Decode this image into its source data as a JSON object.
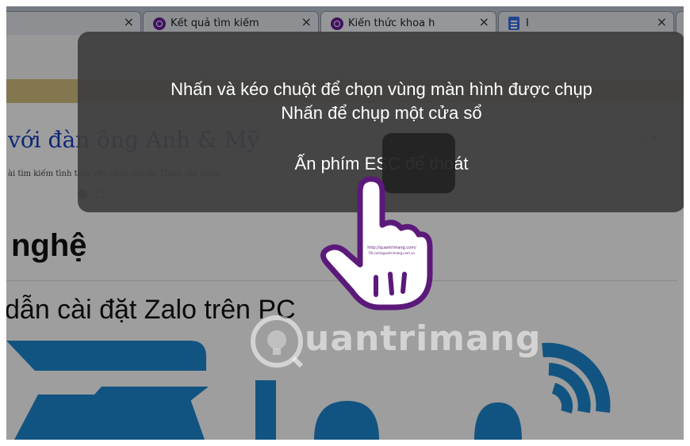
{
  "tabs": [
    {
      "label": "",
      "close": "×"
    },
    {
      "label": "Kết quả tìm kiếm",
      "close": "×",
      "icon": "quantrimang-icon"
    },
    {
      "label": "Kiến thức khoa h",
      "close": "×",
      "icon": "quantrimang-icon"
    },
    {
      "label": "I",
      "close": "×",
      "icon": "document-icon"
    }
  ],
  "ad": {
    "title": "với đàn ông Anh & Mỹ",
    "subtitle": "ài tìm kiếm tình tình yêu chân thành. Tham gia ngay!",
    "badge": "ⓘ✕"
  },
  "page": {
    "section_title": "nghệ",
    "article_title": "dẫn cài đặt Zalo trên PC"
  },
  "capture_overlay": {
    "line1": "Nhấn và kéo chuột để chọn vùng màn hình được chụp",
    "line2": "Nhấn để chụp một cửa sổ",
    "line3": "Ấn phím ESC để thoát"
  },
  "watermark": {
    "text": "uantrimang",
    "cursor_caption_1": "http://quantrimang.com/",
    "cursor_caption_2": "FB.com/quantrimang.com.vn"
  },
  "colors": {
    "tab_strip": "#bfc6d2",
    "ad_link": "#1a3fbf",
    "zalo_blue": "#1e88d0",
    "hand_outline": "#5b1a7a"
  }
}
